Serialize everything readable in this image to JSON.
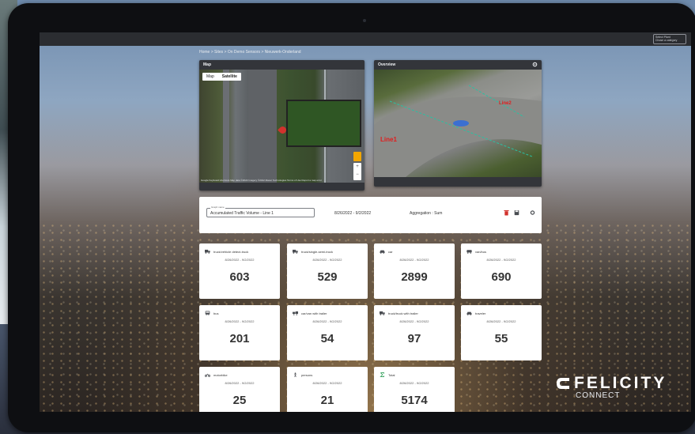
{
  "topbar": {
    "user_label": "Select Plant",
    "user_value": "Chose a category"
  },
  "breadcrumb": "Home > Sites > On Demo Sensors > Nieuwerk-Onderland",
  "map_panel": {
    "title": "Map",
    "tabs": [
      "Map",
      "Satellite"
    ],
    "active_tab": "Satellite",
    "credit": "Google  Keyboard shortcuts  Map data ©2022 Imagery ©2022 Maxar Technologies  Terms of Use  Report a map error"
  },
  "overview_panel": {
    "title": "Overview",
    "line_labels": [
      "Line1",
      "Line2"
    ]
  },
  "toolbar": {
    "select_label": "Graph name",
    "select_value": "Accumulated Traffic Volume - Line 1",
    "date_range": "8/26/2022 - 9/2/2022",
    "aggregation": "Aggregation : Sum"
  },
  "cards": [
    {
      "title": "truck/vehicle detect-truck",
      "range": "8/26/2022 - 9/2/2022",
      "value": "603",
      "icon": "truck-icon"
    },
    {
      "title": "truck/single-semi-truck",
      "range": "8/26/2022 - 9/2/2022",
      "value": "529",
      "icon": "truck-icon"
    },
    {
      "title": "car",
      "range": "8/26/2022 - 9/2/2022",
      "value": "2899",
      "icon": "car-icon"
    },
    {
      "title": "van/bus",
      "range": "8/26/2022 - 9/2/2022",
      "value": "690",
      "icon": "van-icon"
    },
    {
      "title": "bus",
      "range": "8/26/2022 - 9/2/2022",
      "value": "201",
      "icon": "bus-icon"
    },
    {
      "title": "car/van with trailer",
      "range": "8/26/2022 - 9/2/2022",
      "value": "54",
      "icon": "trailer-icon"
    },
    {
      "title": "truck/truck with trailer",
      "range": "8/26/2022 - 9/2/2022",
      "value": "97",
      "icon": "truck-icon"
    },
    {
      "title": "traveler",
      "range": "8/26/2022 - 9/2/2022",
      "value": "55",
      "icon": "car-icon"
    },
    {
      "title": "motorbike",
      "range": "8/26/2022 - 9/2/2022",
      "value": "25",
      "icon": "motorbike-icon"
    },
    {
      "title": "persons",
      "range": "8/26/2022 - 9/2/2022",
      "value": "21",
      "icon": "person-icon"
    },
    {
      "title": "Total",
      "range": "8/26/2022 - 9/2/2022",
      "value": "5174",
      "icon": "sum-icon"
    }
  ],
  "brand": {
    "name": "FELICITY",
    "sub": "CONNECT"
  },
  "colors": {
    "accent_red": "#d2322d",
    "total_green": "#2e9e57",
    "panel_dark": "#33353a"
  }
}
